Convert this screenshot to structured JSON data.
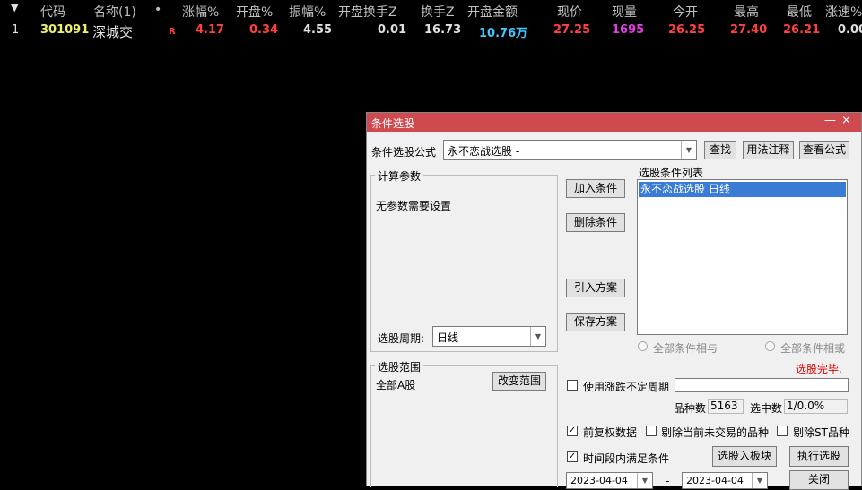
{
  "colors": {
    "header_text": "#c0c0c0",
    "code": "#f0f070",
    "name": "#e8e8e8",
    "up": "#ff4040",
    "neutral": "#e0e0e0",
    "amount": "#40c8ff",
    "volume": "#e040e0",
    "dialog_title_bg": "#cf4a4f",
    "selection": "#3a7bd5",
    "status_red": "#e00000"
  },
  "quote_table": {
    "headers": [
      "代码",
      "名称(1)",
      "•",
      "涨幅%",
      "开盘%",
      "振幅%",
      "开盘换手Z",
      "换手Z",
      "开盘金额",
      "现价",
      "现量",
      "今开",
      "最高",
      "最低",
      "涨速%"
    ],
    "row": {
      "index": "1",
      "code": "301091",
      "name": "深城交",
      "flag": "R",
      "change_pct": "4.17",
      "open_pct": "0.34",
      "amplitude_pct": "4.55",
      "open_turnover": "0.01",
      "turnover": "16.73",
      "open_amount": "10.76万",
      "price": "27.25",
      "volume": "1695",
      "open": "26.25",
      "high": "27.40",
      "low": "26.21",
      "speed": "0.00"
    }
  },
  "dialog": {
    "title": "条件选股",
    "minimize_glyph": "—",
    "close_glyph": "×",
    "formula_label": "条件选股公式",
    "formula_value": "永不恋战选股 -",
    "find_button": "查找",
    "usage_button": "用法注释",
    "view_formula_button": "查看公式",
    "params_group": "计算参数",
    "params_text": "无参数需要设置",
    "period_label": "选股周期:",
    "period_value": "日线",
    "add_button": "加入条件",
    "delete_button": "删除条件",
    "import_button": "引入方案",
    "save_button": "保存方案",
    "cond_list_label": "选股条件列表",
    "cond_items": [
      "永不恋战选股  日线"
    ],
    "radio_and": "全部条件相与",
    "radio_or": "全部条件相或",
    "status": "选股完毕.",
    "range_group": "选股范围",
    "range_value": "全部A股",
    "change_range_button": "改变范围",
    "use_uncertain_period": "使用涨跌不定周期",
    "count_label": "品种数",
    "count_value": "5163",
    "selected_label": "选中数",
    "selected_value": "1/0.0%",
    "pre_adjust_label": "前复权数据",
    "pre_adjust_checked": true,
    "exclude_untraded_label": "剔除当前未交易的品种",
    "exclude_st_label": "剔除ST品种",
    "timerange_label": "时间段内满足条件",
    "timerange_checked": true,
    "to_block_button": "选股入板块",
    "exec_button": "执行选股",
    "date_from": "2023-04-04",
    "date_sep": "-",
    "date_to": "2023-04-04",
    "close_button": "关闭",
    "check_glyph": "✓",
    "arrow_glyph": "▼"
  }
}
